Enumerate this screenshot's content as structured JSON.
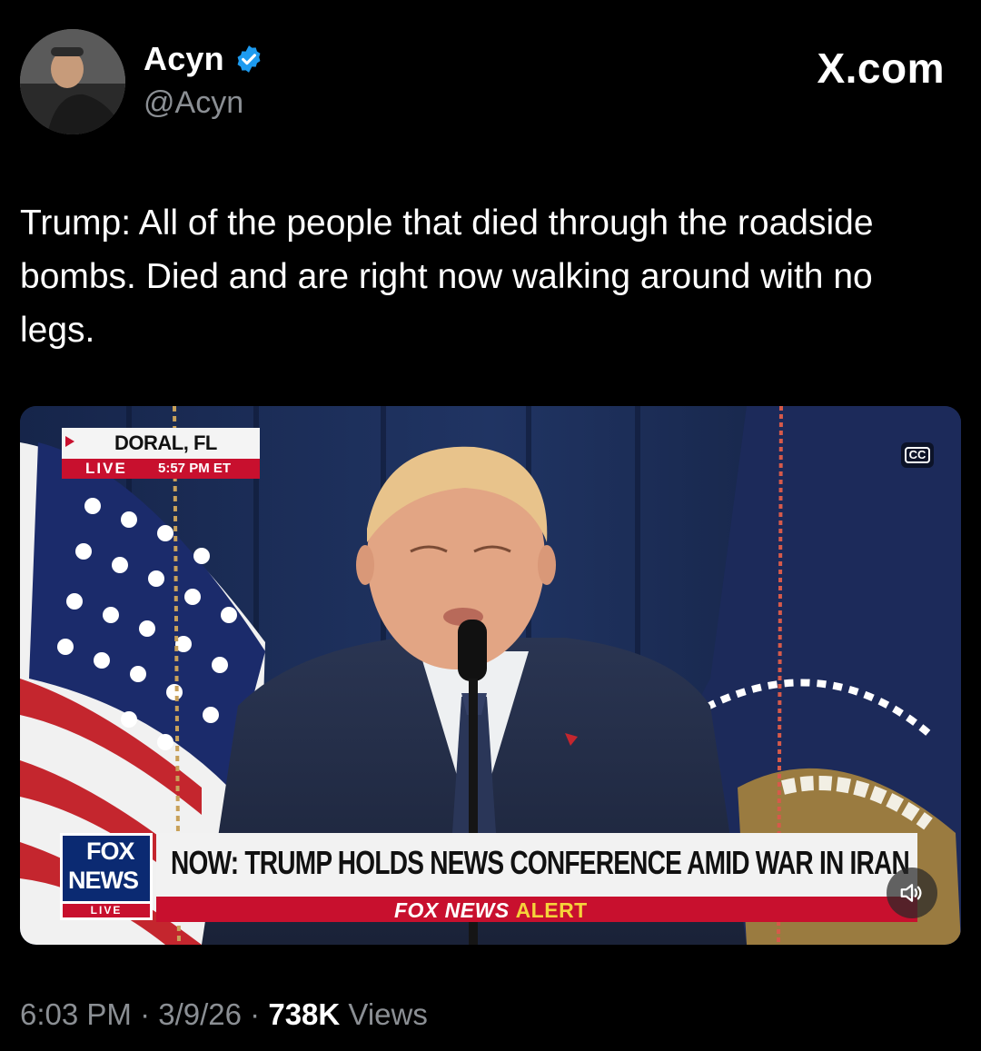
{
  "header": {
    "display_name": "Acyn",
    "handle": "@Acyn",
    "site_logo": "X.com",
    "verified_icon": "verified-badge-icon"
  },
  "tweet": {
    "text": "Trump: All of the people that died through the roadside bombs. Died and are right now walking around with no legs."
  },
  "video": {
    "location_city": "DORAL, FL",
    "live_label": "LIVE",
    "time": "5:57 PM ET",
    "cc_label": "CC",
    "fox_logo_top": "FOX",
    "fox_logo_bottom": "NEWS",
    "fox_logo_live": "LIVE",
    "headline": "NOW: TRUMP HOLDS NEWS CONFERENCE AMID WAR IN IRAN",
    "alert_brand": "FOX NEWS",
    "alert_word": "ALERT",
    "mute_icon": "speaker-muted-icon",
    "captions_icon": "closed-captions-icon"
  },
  "meta": {
    "time": "6:03 PM",
    "date": "3/9/26",
    "views_count": "738K",
    "views_label": "Views",
    "separator": "·"
  },
  "colors": {
    "background": "#000000",
    "verified_blue": "#1d9bf0",
    "muted_text": "#8b8f94",
    "fox_red": "#c8102e",
    "fox_blue": "#0b2a72",
    "alert_yellow": "#f5d33b"
  }
}
